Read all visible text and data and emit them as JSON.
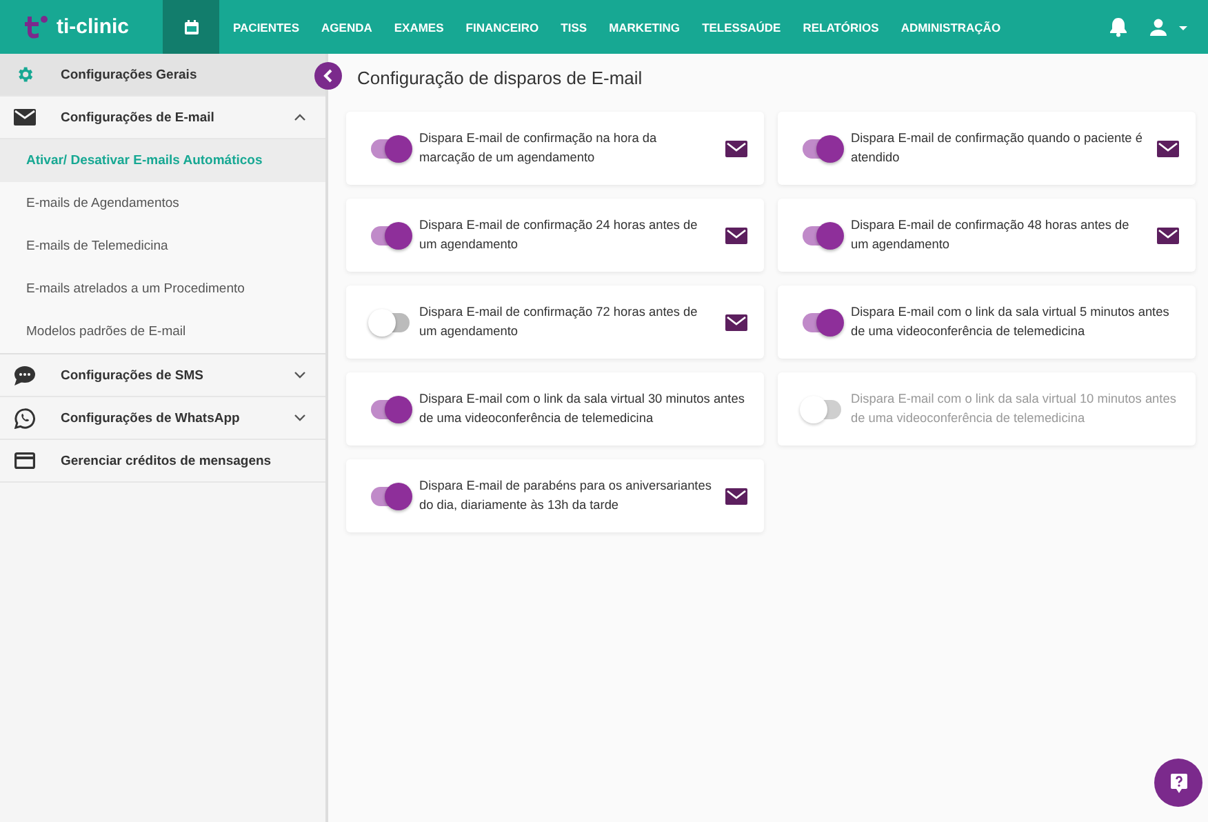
{
  "brand": {
    "name": "ti-clinic"
  },
  "nav": [
    {
      "kind": "icon",
      "selected": true
    },
    {
      "kind": "text",
      "label": "PACIENTES",
      "selected": false
    },
    {
      "kind": "text",
      "label": "AGENDA",
      "selected": false
    },
    {
      "kind": "text",
      "label": "EXAMES",
      "selected": false
    },
    {
      "kind": "text",
      "label": "FINANCEIRO",
      "selected": false
    },
    {
      "kind": "text",
      "label": "TISS",
      "selected": false
    },
    {
      "kind": "text",
      "label": "MARKETING",
      "selected": false
    },
    {
      "kind": "text",
      "label": "TELESSAÚDE",
      "selected": false
    },
    {
      "kind": "text",
      "label": "RELATÓRIOS",
      "selected": false
    },
    {
      "kind": "text",
      "label": "ADMINISTRAÇÃO",
      "selected": false
    }
  ],
  "sidebar": {
    "items": [
      {
        "kind": "gear",
        "label": "Configurações Gerais",
        "selected": true
      },
      {
        "kind": "mail",
        "label": "Configurações de E-mail",
        "selected": false,
        "expanded": true,
        "children": [
          {
            "label": "Ativar/ Desativar E-mails Automáticos",
            "selected": true
          },
          {
            "label": "E-mails de Agendamentos",
            "selected": false
          },
          {
            "label": "E-mails de Telemedicina",
            "selected": false
          },
          {
            "label": "E-mails atrelados a um Procedimento",
            "selected": false
          },
          {
            "label": "Modelos padrões de E-mail",
            "selected": false
          }
        ]
      },
      {
        "kind": "sms",
        "label": "Configurações de SMS",
        "selected": false,
        "expanded": false
      },
      {
        "kind": "whatsapp",
        "label": "Configurações de WhatsApp",
        "selected": false,
        "expanded": false
      },
      {
        "kind": "card",
        "label": "Gerenciar créditos de mensagens",
        "selected": false
      }
    ]
  },
  "page": {
    "title": "Configuração de disparos de E-mail"
  },
  "settings": [
    {
      "kind": "email",
      "text": "Dispara E-mail de confirmação na hora da marcação de um agendamento",
      "on": true,
      "disabled": false
    },
    {
      "kind": "email",
      "text": "Dispara E-mail de confirmação quando o paciente é atendido",
      "on": true,
      "disabled": false
    },
    {
      "kind": "email",
      "text": "Dispara E-mail de confirmação 24 horas antes de um agendamento",
      "on": true,
      "disabled": false
    },
    {
      "kind": "email",
      "text": "Dispara E-mail de confirmação 48 horas antes de um agendamento",
      "on": true,
      "disabled": false
    },
    {
      "kind": "email",
      "text": "Dispara E-mail de confirmação 72 horas antes de um agendamento",
      "on": false,
      "disabled": false
    },
    {
      "kind": "plain",
      "text": "Dispara E-mail com o link da sala virtual 5 minutos antes de uma videoconferência de telemedicina",
      "on": true,
      "disabled": false
    },
    {
      "kind": "plain",
      "text": "Dispara E-mail com o link da sala virtual 30 minutos antes de uma videoconferência de telemedicina",
      "on": true,
      "disabled": false
    },
    {
      "kind": "plain",
      "text": "Dispara E-mail com o link da sala virtual 10 minutos antes de uma videoconferência de telemedicina",
      "on": false,
      "disabled": true
    },
    {
      "kind": "email",
      "text": "Dispara E-mail de parabéns para os aniversariantes do dia, diariamente às 13h da tarde",
      "on": true,
      "disabled": false
    }
  ]
}
